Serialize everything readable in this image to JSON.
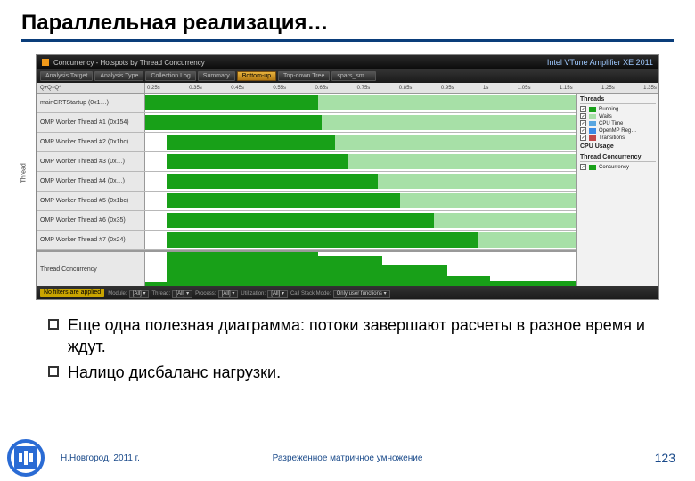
{
  "title": "Параллельная реализация…",
  "vtune": {
    "window_title": "Concurrency - Hotspots by Thread Concurrency",
    "product": "Intel VTune Amplifier XE 2011",
    "tabs": [
      "Analysis Target",
      "Analysis Type",
      "Collection Log",
      "Summary",
      "Bottom-up",
      "Top-down Tree",
      "spars_sm…"
    ],
    "ruler_left": "Q+Q−Q*",
    "ticks": [
      "0.25s",
      "0.35s",
      "0.45s",
      "0.55s",
      "0.65s",
      "0.75s",
      "0.85s",
      "0.95s",
      "1s",
      "1.05s",
      "1.15s",
      "1.25s",
      "1.35s"
    ],
    "ylabel": "Thread",
    "threads": [
      {
        "label": "mainCRTStartup (0x1…)",
        "dark": [
          0,
          40
        ],
        "light": [
          40,
          100
        ]
      },
      {
        "label": "OMP Worker Thread #1 (0x154)",
        "dark": [
          0,
          41
        ],
        "light": [
          41,
          100
        ]
      },
      {
        "label": "OMP Worker Thread #2 (0x1bc)",
        "dark": [
          5,
          44
        ],
        "light": [
          44,
          100
        ]
      },
      {
        "label": "OMP Worker Thread #3 (0x…)",
        "dark": [
          5,
          47
        ],
        "light": [
          47,
          100
        ]
      },
      {
        "label": "OMP Worker Thread #4 (0x…)",
        "dark": [
          5,
          54
        ],
        "light": [
          54,
          100
        ]
      },
      {
        "label": "OMP Worker Thread #5 (0x1bc)",
        "dark": [
          5,
          59
        ],
        "light": [
          59,
          100
        ]
      },
      {
        "label": "OMP Worker Thread #6 (0x35)",
        "dark": [
          5,
          67
        ],
        "light": [
          67,
          100
        ]
      },
      {
        "label": "OMP Worker Thread #7 (0x24)",
        "dark": [
          5,
          77
        ],
        "light": [
          77,
          100
        ]
      }
    ],
    "concurrency_label": "Thread Concurrency",
    "legend": {
      "h1": "Threads",
      "items1": [
        {
          "label": "Running",
          "color": "#18a018"
        },
        {
          "label": "Waits",
          "color": "#a7e0a7"
        },
        {
          "label": "CPU Time",
          "color": "#5aa6e0"
        },
        {
          "label": "OpenMP Reg…",
          "color": "#3a8be6"
        },
        {
          "label": "Transitions",
          "color": "#c24a4a"
        }
      ],
      "h2": "CPU Usage",
      "h3": "Thread Concurrency",
      "items3": [
        {
          "label": "Concurrency",
          "color": "#18a018"
        }
      ]
    },
    "status": {
      "pill": "No filters are applied",
      "filters": [
        {
          "k": "Module:",
          "v": "[All]"
        },
        {
          "k": "Thread:",
          "v": "[All]"
        },
        {
          "k": "Process:",
          "v": "[All]"
        },
        {
          "k": "Utilization:",
          "v": "[All]"
        },
        {
          "k": "Call Stack Mode:",
          "v": "Only user functions"
        }
      ]
    }
  },
  "bullets": [
    "Еще одна полезная диаграмма: потоки завершают расчеты в разное время и ждут.",
    "Налицо дисбаланс нагрузки."
  ],
  "footer": {
    "left": "Н.Новгород, 2011 г.",
    "center": "Разреженное матричное умножение",
    "page": "123"
  }
}
